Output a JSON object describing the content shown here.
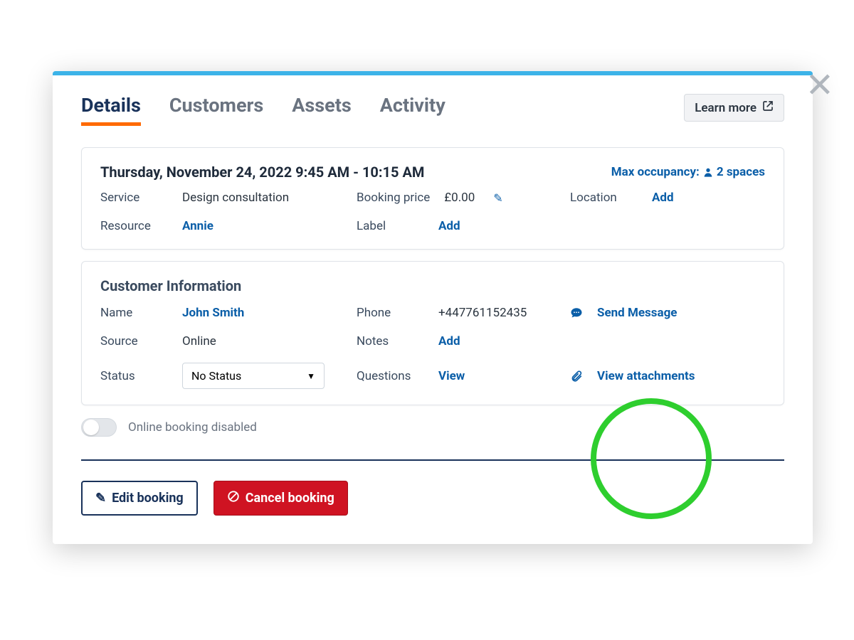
{
  "tabs": {
    "details": "Details",
    "customers": "Customers",
    "assets": "Assets",
    "activity": "Activity"
  },
  "learn_more": "Learn more",
  "booking": {
    "datetime": "Thursday, November 24, 2022 9:45 AM - 10:15 AM",
    "max_occupancy_label": "Max occupancy:",
    "max_occupancy_value": "2 spaces",
    "service_label": "Service",
    "service_value": "Design consultation",
    "booking_price_label": "Booking price",
    "booking_price_value": "£0.00",
    "location_label": "Location",
    "location_link": "Add",
    "resource_label": "Resource",
    "resource_value": "Annie",
    "label_label": "Label",
    "label_link": "Add"
  },
  "customer": {
    "section_title": "Customer Information",
    "name_label": "Name",
    "name_value": "John Smith",
    "phone_label": "Phone",
    "phone_value": "+447761152435",
    "send_message": "Send Message",
    "source_label": "Source",
    "source_value": "Online",
    "notes_label": "Notes",
    "notes_link": "Add",
    "view_attachments": "View attachments",
    "status_label": "Status",
    "status_value": "No Status",
    "questions_label": "Questions",
    "questions_link": "View"
  },
  "online_booking": "Online booking disabled",
  "actions": {
    "edit": "Edit booking",
    "cancel": "Cancel booking"
  }
}
